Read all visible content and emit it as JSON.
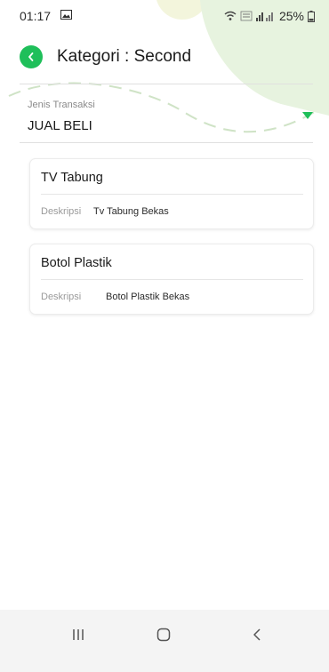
{
  "status_bar": {
    "time": "01:17",
    "battery": "25%",
    "icons": [
      "gallery-icon",
      "wifi-icon",
      "volte-icon",
      "signal-icon",
      "battery-icon"
    ]
  },
  "header": {
    "back_icon": "chevron-left-icon",
    "title": "Kategori : Second"
  },
  "transaction_field": {
    "label": "Jenis Transaksi",
    "value": "JUAL BELI",
    "icon": "dropdown-triangle-icon"
  },
  "items": [
    {
      "title": "TV Tabung",
      "desc_label": "Deskripsi",
      "desc_value": "Tv Tabung Bekas"
    },
    {
      "title": "Botol Plastik",
      "desc_label": "Deskripsi",
      "desc_value": "Botol Plastik Bekas"
    }
  ],
  "nav": {
    "icons": [
      "recent-apps-icon",
      "home-icon",
      "back-icon"
    ]
  },
  "colors": {
    "accent": "#1fbf5a",
    "bg_deco": "#eef6e4"
  }
}
